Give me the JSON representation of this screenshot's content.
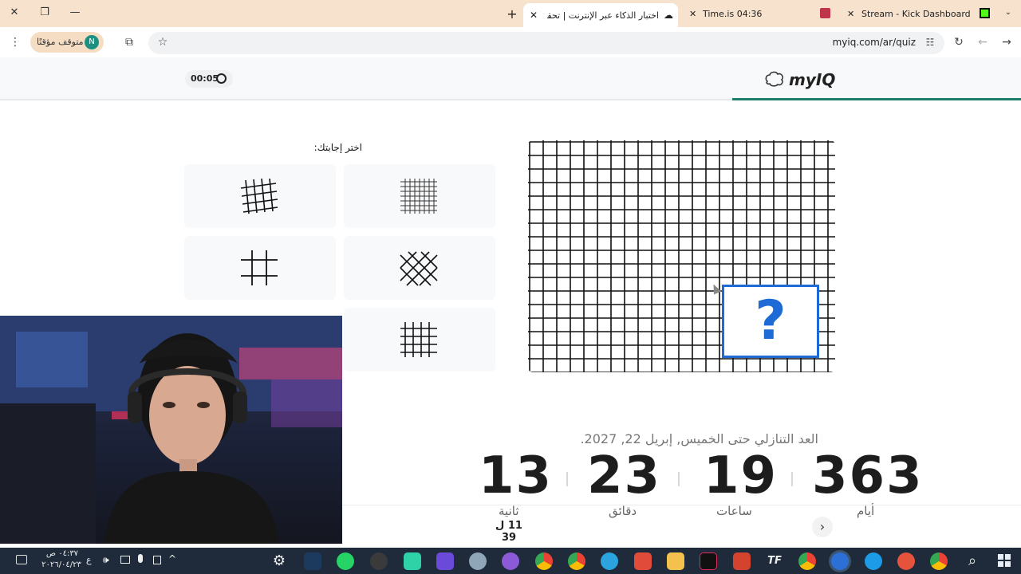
{
  "browser": {
    "tabs": [
      {
        "title": "Stream - Kick Dashboard"
      },
      {
        "title": "Time.is 04:36"
      },
      {
        "title": "اختبار الذكاء عبر الإنترنت | تحقق من..."
      }
    ],
    "url": "myiq.com/ar/quiz",
    "profile_label": "متوقف مؤقتًا",
    "profile_initial": "N"
  },
  "app": {
    "logo_text": "myIQ",
    "timer": "00:05"
  },
  "quiz": {
    "prompt": "اختر إجابتك:",
    "question_mark": "?",
    "options": [
      {
        "icon": "fine-grid-icon"
      },
      {
        "icon": "skewed-grid-icon"
      },
      {
        "icon": "diagonal-grid-icon"
      },
      {
        "icon": "hash-grid-icon"
      },
      {
        "icon": "square-grid-icon"
      }
    ],
    "progress_text": "11 ل 39"
  },
  "countdown": {
    "heading": "العد التنازلي حتى الخميس, إبريل 22, 2027.",
    "days": "363",
    "days_label": "أيام",
    "hours": "19",
    "hours_label": "ساعات",
    "minutes": "23",
    "minutes_label": "دقائق",
    "seconds": "13",
    "seconds_label": "ثانية"
  },
  "taskbar": {
    "time": "٠٤:٣٧ ص",
    "date": "٢٠٢٦/٠٤/٢٣",
    "lang": "ع"
  }
}
